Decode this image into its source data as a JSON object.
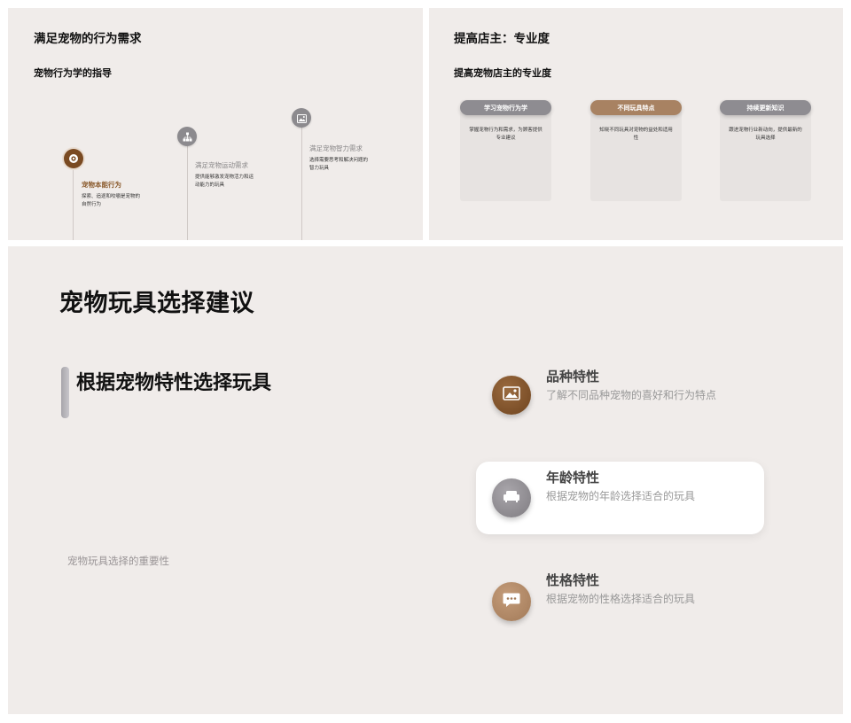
{
  "slide1": {
    "title": "满足宠物的行为需求",
    "subtitle": "宠物行为学的指导",
    "timeline": [
      {
        "heading": "宠物本能行为",
        "desc": "探索、追逐和咬嚼是宠物的自然行为",
        "icon": "target-icon"
      },
      {
        "heading": "满足宠物运动需求",
        "desc": "提供能够激发宠物活力和运动能力的玩具",
        "icon": "network-icon"
      },
      {
        "heading": "满足宠物智力需求",
        "desc": "选择需要思考和解决问题的智力玩具",
        "icon": "image-icon"
      }
    ]
  },
  "slide2": {
    "title": "提高店主：专业度",
    "subtitle": "提高宠物店主的专业度",
    "cards": [
      {
        "label": "学习宠物行为学",
        "desc": "掌握宠物行为和需求，为顾客提供专业建议"
      },
      {
        "label": "不同玩具特点",
        "desc": "知晓不同玩具对宠物的益处和适用性"
      },
      {
        "label": "持续更新知识",
        "desc": "跟进宠物行业新动向，提供最新的玩具选择"
      }
    ],
    "colors": {
      "gray": "#8e8c91",
      "brown": "#a88262"
    }
  },
  "slide3": {
    "title": "宠物玩具选择建议",
    "section_title": "根据宠物特性选择玩具",
    "footnote": "宠物玩具选择的重要性",
    "features": [
      {
        "heading": "品种特性",
        "desc": "了解不同品种宠物的喜好和行为特点",
        "icon": "image-icon"
      },
      {
        "heading": "年龄特性",
        "desc": "根据宠物的年龄选择适合的玩具",
        "icon": "sofa-icon"
      },
      {
        "heading": "性格特性",
        "desc": "根据宠物的性格选择适合的玩具",
        "icon": "chat-bubble-icon"
      }
    ],
    "colors": {
      "brown_dark": "#7b4f2a",
      "gray": "#8e8b90",
      "tan": "#b08766"
    }
  }
}
